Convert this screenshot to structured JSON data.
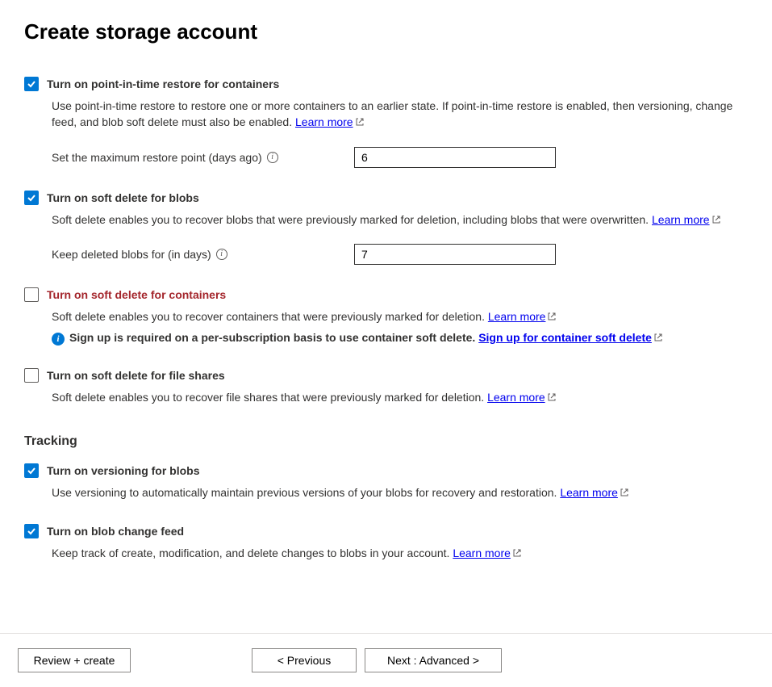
{
  "title": "Create storage account",
  "options": {
    "pitr": {
      "checked": true,
      "label": "Turn on point-in-time restore for containers",
      "description": "Use point-in-time restore to restore one or more containers to an earlier state. If point-in-time restore is enabled, then versioning, change feed, and blob soft delete must also be enabled. ",
      "learn_more": "Learn more",
      "field_label": "Set the maximum restore point (days ago)",
      "field_value": "6"
    },
    "soft_delete_blobs": {
      "checked": true,
      "label": "Turn on soft delete for blobs",
      "description": "Soft delete enables you to recover blobs that were previously marked for deletion, including blobs that were overwritten. ",
      "learn_more": "Learn more",
      "field_label": "Keep deleted blobs for (in days)",
      "field_value": "7"
    },
    "soft_delete_containers": {
      "checked": false,
      "error": true,
      "label": "Turn on soft delete for containers",
      "description": "Soft delete enables you to recover containers that were previously marked for deletion. ",
      "learn_more": "Learn more",
      "signup_text": "Sign up is required on a per-subscription basis to use container soft delete. ",
      "signup_link": "Sign up for container soft delete"
    },
    "soft_delete_shares": {
      "checked": false,
      "label": "Turn on soft delete for file shares",
      "description": "Soft delete enables you to recover file shares that were previously marked for deletion. ",
      "learn_more": "Learn more"
    }
  },
  "tracking": {
    "heading": "Tracking",
    "versioning": {
      "checked": true,
      "label": "Turn on versioning for blobs",
      "description": "Use versioning to automatically maintain previous versions of your blobs for recovery and restoration. ",
      "learn_more": "Learn more"
    },
    "change_feed": {
      "checked": true,
      "label": "Turn on blob change feed",
      "description": "Keep track of create, modification, and delete changes to blobs in your account. ",
      "learn_more": "Learn more"
    }
  },
  "footer": {
    "review_create": "Review + create",
    "previous": "< Previous",
    "next": "Next : Advanced >"
  }
}
